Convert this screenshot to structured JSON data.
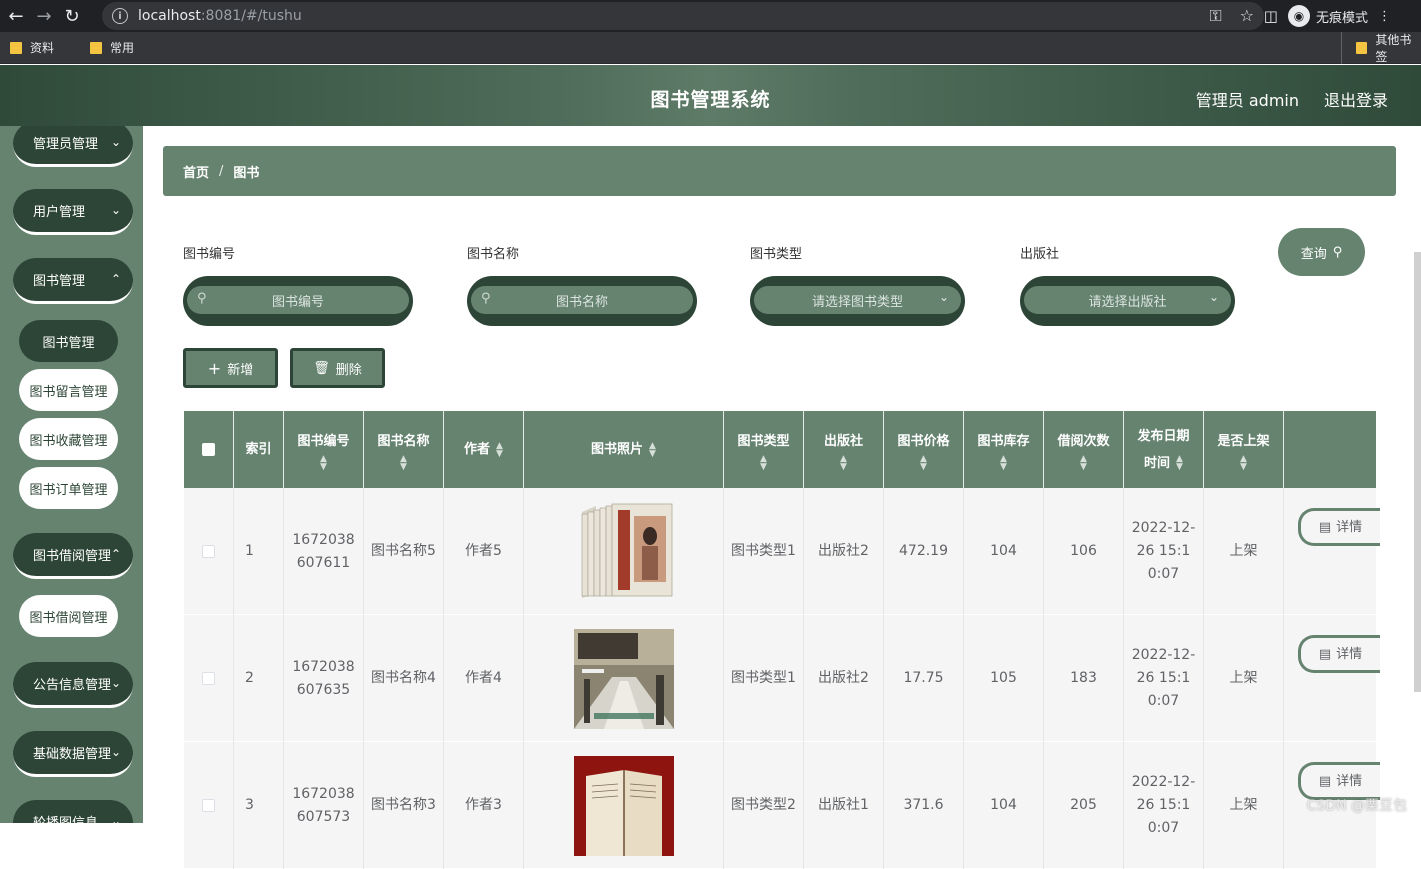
{
  "browser": {
    "url_host": "localhost",
    "url_path": ":8081/#/tushu",
    "incognito_label": "无痕模式",
    "bookmarks": [
      "资料",
      "常用"
    ],
    "other_bookmarks": "其他书签"
  },
  "header": {
    "title": "图书管理系统",
    "user": "管理员 admin",
    "logout": "退出登录"
  },
  "sidebar": {
    "groups": [
      "管理员管理",
      "用户管理",
      "图书管理",
      "图书借阅管理",
      "公告信息管理",
      "基础数据管理",
      "轮播图信息"
    ],
    "book_submenu": [
      "图书管理",
      "图书留言管理",
      "图书收藏管理",
      "图书订单管理"
    ],
    "borrow_submenu": [
      "图书借阅管理"
    ]
  },
  "breadcrumb": {
    "home": "首页",
    "sep": "/",
    "current": "图书"
  },
  "search": {
    "fields": [
      {
        "label": "图书编号",
        "placeholder": "图书编号"
      },
      {
        "label": "图书名称",
        "placeholder": "图书名称"
      },
      {
        "label": "图书类型",
        "placeholder": "请选择图书类型"
      },
      {
        "label": "出版社",
        "placeholder": "请选择出版社"
      }
    ],
    "query_label": "查询"
  },
  "actions": {
    "add": "新增",
    "delete": "删除"
  },
  "table": {
    "headers": {
      "index": "索引",
      "code": "图书编号",
      "name": "图书名称",
      "author": "作者",
      "photo": "图书照片",
      "type": "图书类型",
      "publisher": "出版社",
      "price": "图书价格",
      "stock": "图书库存",
      "borrow_count": "借阅次数",
      "publish_date_1": "发布日期",
      "publish_date_2": "时间",
      "on_shelf": "是否上架"
    },
    "rows": [
      {
        "index": "1",
        "code": "1672038607611",
        "name": "图书名称5",
        "author": "作者5",
        "type": "图书类型1",
        "publisher": "出版社2",
        "price": "472.19",
        "stock": "104",
        "borrow_count": "106",
        "date": "2022-12-26 15:10:07",
        "on_shelf": "上架",
        "detail": "详情"
      },
      {
        "index": "2",
        "code": "1672038607635",
        "name": "图书名称4",
        "author": "作者4",
        "type": "图书类型1",
        "publisher": "出版社2",
        "price": "17.75",
        "stock": "105",
        "borrow_count": "183",
        "date": "2022-12-26 15:10:07",
        "on_shelf": "上架",
        "detail": "详情"
      },
      {
        "index": "3",
        "code": "1672038607573",
        "name": "图书名称3",
        "author": "作者3",
        "type": "图书类型2",
        "publisher": "出版社1",
        "price": "371.6",
        "stock": "104",
        "borrow_count": "205",
        "date": "2022-12-26 15:10:07",
        "on_shelf": "上架",
        "detail": "详情"
      }
    ]
  },
  "watermark": "CSDN @栗豆包",
  "colors": {
    "primary": "#668370",
    "dark": "#2d4536"
  }
}
